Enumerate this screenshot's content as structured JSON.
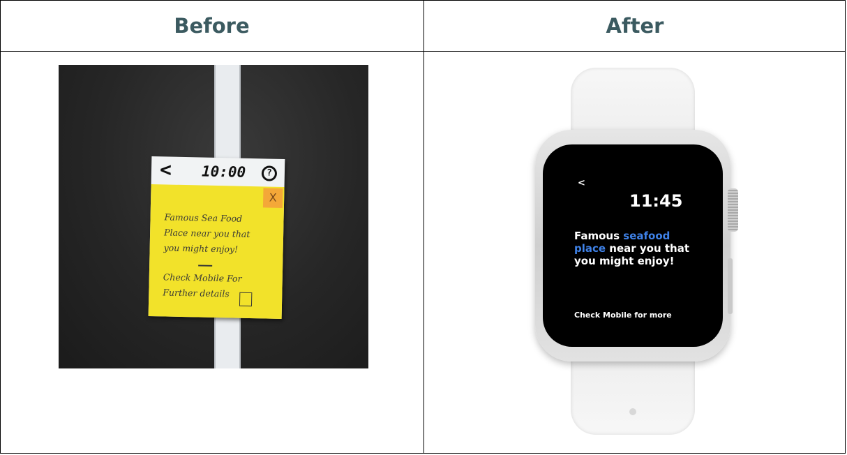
{
  "headers": {
    "before": "Before",
    "after": "After"
  },
  "before_sketch": {
    "back_glyph": "<",
    "time": "10:00",
    "help_glyph": "?",
    "close_glyph": "X",
    "message_lines": [
      "Famous Sea Food",
      "Place near you that",
      "you might enjoy!"
    ],
    "sub_lines": [
      "Check Mobile For",
      "Further details"
    ]
  },
  "after_watch": {
    "back_glyph": "<",
    "time": "11:45",
    "message_start": "Famous ",
    "message_highlight_1": "seafood",
    "message_highlight_2": "place",
    "message_end": " near you that you might enjoy!",
    "footer": "Check Mobile for more",
    "highlight_color": "#3f82e8"
  },
  "colors": {
    "header_text": "#3b5a60",
    "sticky_note": "#f2e22a",
    "sticky_corner": "#f4a838",
    "watch_screen": "#000000"
  }
}
